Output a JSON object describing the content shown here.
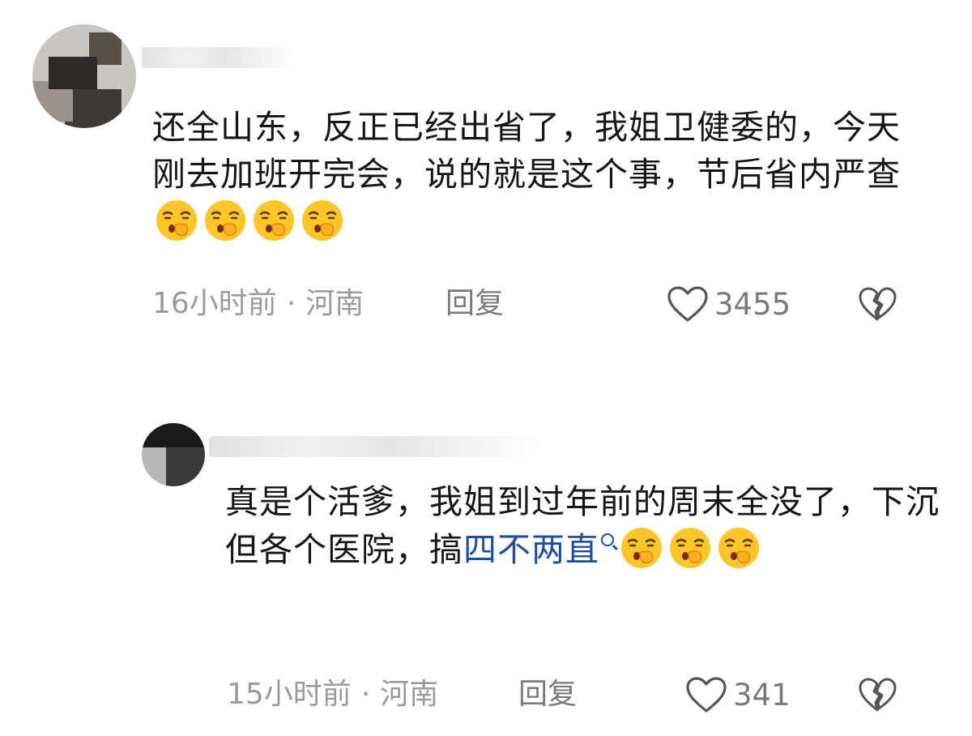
{
  "comments": [
    {
      "text": "还全山东，反正已经出省了，我姐卫健委的，今天刚去加班开完会，说的就是这个事，节后省内严查",
      "emoji_count": 4,
      "emoji_icon": "shush-emoji-icon",
      "time": "16小时前",
      "location": "河南",
      "reply_label": "回复",
      "likes": "3455"
    },
    {
      "text_before_link": "真是个活爹，我姐到过年前的周末全没了，下沉但各个医院，搞",
      "link_text": "四不两直",
      "emoji_count": 3,
      "emoji_icon": "shush-emoji-icon",
      "time": "15小时前",
      "location": "河南",
      "reply_label": "回复",
      "likes": "341"
    }
  ],
  "separator": "·",
  "colors": {
    "link": "#1f4e9e",
    "meta_text": "#9b9b9b",
    "body_text": "#161616",
    "emoji_face": "#ffc629"
  }
}
